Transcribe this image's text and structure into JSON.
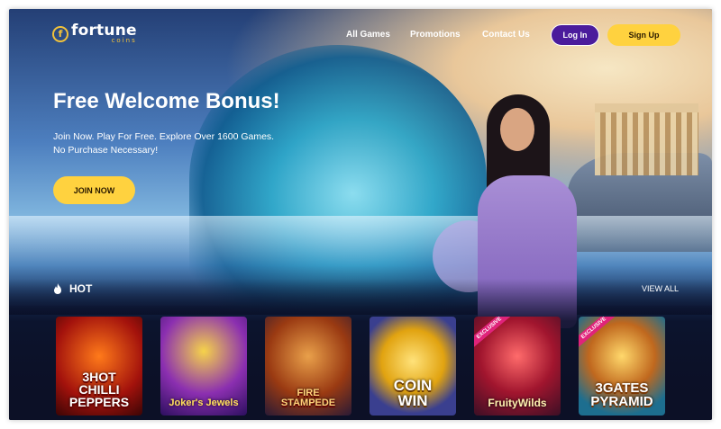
{
  "header": {
    "logo_name": "fortune",
    "logo_sub": "coins",
    "logo_mark": "f",
    "nav": [
      "All Games",
      "Promotions",
      "Contact Us"
    ],
    "login_label": "Log In",
    "signup_label": "Sign Up"
  },
  "hero": {
    "title": "Free Welcome Bonus!",
    "line1": "Join Now. Play For Free. Explore Over 1600 Games.",
    "line2": "No Purchase Necessary!",
    "cta_label": "JOIN NOW"
  },
  "hot_section": {
    "title": "HOT",
    "view_all_label": "VIEW ALL",
    "games": [
      {
        "title": "3HOT\nCHILLI\nPEPPERS",
        "badge": ""
      },
      {
        "title": "Joker's Jewels",
        "badge": ""
      },
      {
        "title": "FIRE\nSTAMPEDE",
        "badge": ""
      },
      {
        "title": "COIN\nWIN",
        "badge": ""
      },
      {
        "title": "FruityWilds",
        "badge": "EXCLUSIVE"
      },
      {
        "title": "3GATES\nPYRAMID",
        "badge": "EXCLUSIVE"
      }
    ]
  },
  "colors": {
    "accent_yellow": "#ffd23f",
    "login_purple": "#4b1c9c",
    "logo_gold": "#f2c23a"
  }
}
